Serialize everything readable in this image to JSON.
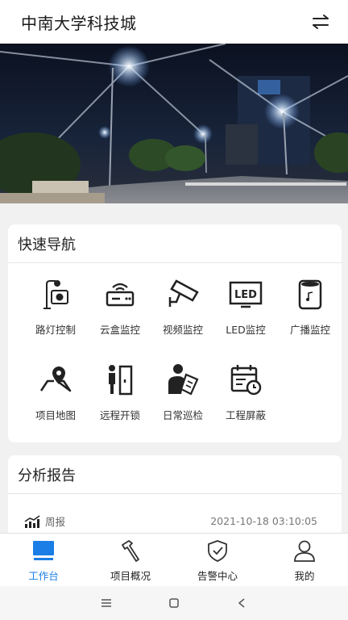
{
  "header": {
    "title": "中南大学科技城"
  },
  "nav": {
    "title": "快速导航",
    "items": [
      {
        "label": "路灯控制",
        "icon": "streetlight-icon"
      },
      {
        "label": "云盒监控",
        "icon": "router-icon"
      },
      {
        "label": "视频监控",
        "icon": "cctv-camera-icon"
      },
      {
        "label": "LED监控",
        "icon": "led-icon"
      },
      {
        "label": "广播监控",
        "icon": "speaker-icon"
      },
      {
        "label": "项目地图",
        "icon": "map-pin-icon"
      },
      {
        "label": "远程开锁",
        "icon": "door-unlock-icon"
      },
      {
        "label": "日常巡检",
        "icon": "inspection-icon"
      },
      {
        "label": "工程屏蔽",
        "icon": "calendar-clock-icon"
      }
    ]
  },
  "report": {
    "title": "分析报告",
    "rows": [
      {
        "label": "周报",
        "date": "2021-10-18 03:10:05"
      }
    ]
  },
  "tabs": [
    {
      "label": "工作台",
      "icon": "monitor-icon",
      "active": true
    },
    {
      "label": "项目概况",
      "icon": "hammer-icon"
    },
    {
      "label": "告警中心",
      "icon": "shield-check-icon"
    },
    {
      "label": "我的",
      "icon": "user-icon"
    }
  ],
  "colors": {
    "accent": "#1a7ee6",
    "page_bg": "#f1f1f1"
  }
}
